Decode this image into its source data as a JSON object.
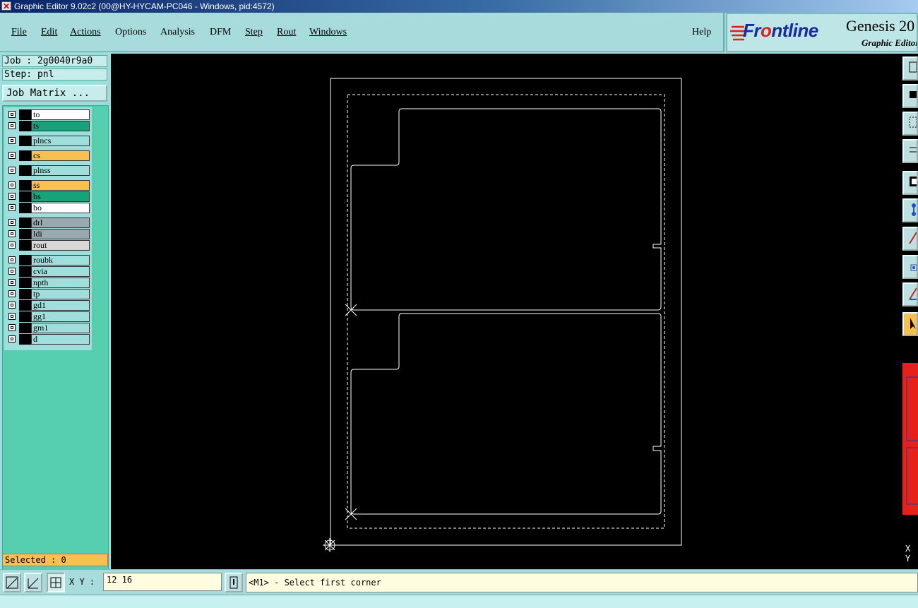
{
  "window": {
    "title": "Graphic Editor 9.02c2 (00@HY-HYCAM-PC046 - Windows, pid:4572)"
  },
  "menu": [
    {
      "label": "File",
      "underline": true
    },
    {
      "label": "Edit",
      "underline": true
    },
    {
      "label": "Actions",
      "underline": true
    },
    {
      "label": "Options",
      "underline": false
    },
    {
      "label": "Analysis",
      "underline": false
    },
    {
      "label": "DFM",
      "underline": false
    },
    {
      "label": "Step",
      "underline": true
    },
    {
      "label": "Rout",
      "underline": true
    },
    {
      "label": "Windows",
      "underline": true
    }
  ],
  "help": "Help",
  "logo": {
    "brand_pre": "Fr",
    "brand_mark": "o",
    "brand_post": "ntline",
    "product": "Genesis 20",
    "subtitle": "Graphic Editor"
  },
  "job": "Job : 2g0040r9a0",
  "step": "Step: pnl",
  "job_matrix": "Job Matrix ...",
  "layers": [
    {
      "name": "to",
      "color": "#ffffff"
    },
    {
      "name": "ts",
      "color": "#17a37a"
    },
    {
      "name": "plncs",
      "color": "#a0dede"
    },
    {
      "name": "cs",
      "color": "#f8c050"
    },
    {
      "name": "plnss",
      "color": "#a0dede"
    },
    {
      "name": "ss",
      "color": "#f8c050"
    },
    {
      "name": "bs",
      "color": "#17a37a"
    },
    {
      "name": "bo",
      "color": "#ffffff"
    },
    {
      "name": "drl",
      "color": "#9aa8b0"
    },
    {
      "name": "ldi",
      "color": "#9aa8b0"
    },
    {
      "name": "rout",
      "color": "#d8d8d8"
    },
    {
      "name": "roubk",
      "color": "#a0dede"
    },
    {
      "name": "cvia",
      "color": "#a0dede"
    },
    {
      "name": "npth",
      "color": "#a0dede"
    },
    {
      "name": "tp",
      "color": "#a0dede"
    },
    {
      "name": "gd1",
      "color": "#a0dede"
    },
    {
      "name": "gg1",
      "color": "#a0dede"
    },
    {
      "name": "gm1",
      "color": "#a0dede"
    },
    {
      "name": "d",
      "color": "#a0dede"
    }
  ],
  "selected": "Selected : 0",
  "xy": {
    "label": "X Y :",
    "value": "12  16"
  },
  "prompt": "<M1> - Select first corner",
  "side_xy": {
    "x": "X",
    "y": "Y"
  }
}
